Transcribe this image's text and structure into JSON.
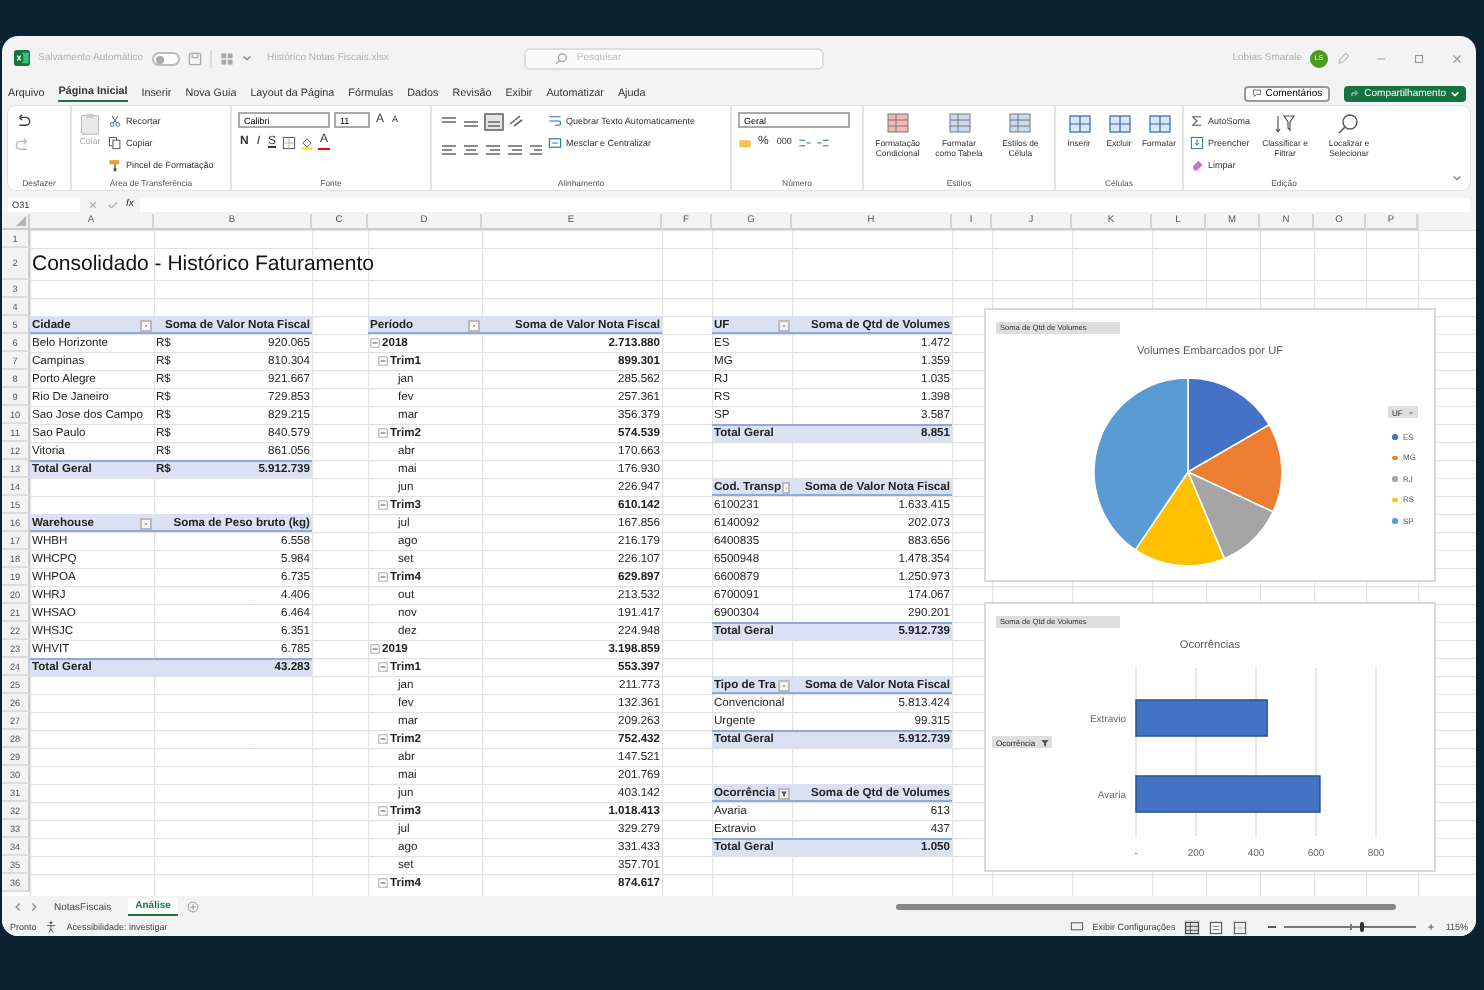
{
  "titlebar": {
    "autosave_label": "Salvamento Automático",
    "autosave_on": false,
    "filename": "Histórico Notas Fiscais.xlsx",
    "search_placeholder": "Pesquisar",
    "user_name": "Lobias Smarale",
    "user_initials": "LS"
  },
  "menu_tabs": [
    {
      "label": "Arquivo",
      "selected": false
    },
    {
      "label": "Página Inicial",
      "selected": true
    },
    {
      "label": "Inserir",
      "selected": false
    },
    {
      "label": "Nova Guia",
      "selected": false
    },
    {
      "label": "Layout da Página",
      "selected": false
    },
    {
      "label": "Fórmulas",
      "selected": false
    },
    {
      "label": "Dados",
      "selected": false
    },
    {
      "label": "Revisão",
      "selected": false
    },
    {
      "label": "Exibir",
      "selected": false
    },
    {
      "label": "Automatizar",
      "selected": false
    },
    {
      "label": "Ajuda",
      "selected": false
    }
  ],
  "comments_button": "Comentários",
  "share_button": "Compartilhamento",
  "ribbon": {
    "undo": {
      "group": "Desfazer"
    },
    "clipboard": {
      "group": "Área de Transferência",
      "paste": "Colar",
      "cut": "Recortar",
      "copy": "Copiar",
      "format_painter": "Pincel de Formatação"
    },
    "font": {
      "group": "Fonte",
      "family": "Calibri",
      "size": "11",
      "grow": "A",
      "shrink": "A",
      "bold": "N",
      "italic": "I",
      "underline": "S",
      "color_letter": "A"
    },
    "alignment": {
      "group": "Alinhamento",
      "wrap": "Quebrar Texto Automaticamente",
      "merge": "Mesclar e Centralizar"
    },
    "number": {
      "group": "Número",
      "format": "Geral",
      "percent": "%",
      "thousands": "000"
    },
    "styles": {
      "group": "Estilos",
      "items": [
        "Formatação Condicional",
        "Formatar como Tabela",
        "Estilos de Célula"
      ]
    },
    "cells": {
      "group": "Células",
      "items": [
        "Inserir",
        "Excluir",
        "Formatar"
      ]
    },
    "editing": {
      "group": "Edição",
      "autosum": "AutoSoma",
      "fill": "Preencher",
      "clear": "Limpar",
      "sort": "Classificar e Filtrar",
      "find": "Localizar e Selecionar"
    }
  },
  "formula_bar": {
    "cell_ref": "O31",
    "fx": "fx"
  },
  "sheet": {
    "columns": [
      "A",
      "B",
      "C",
      "D",
      "E",
      "F",
      "G",
      "H",
      "I",
      "J",
      "K",
      "L",
      "M",
      "N",
      "O",
      "P"
    ],
    "row_numbers": [
      "1",
      "2",
      "3",
      "4",
      "5",
      "6",
      "7",
      "8",
      "9",
      "10",
      "11",
      "12",
      "13",
      "14",
      "15",
      "16",
      "17",
      "18",
      "19",
      "20",
      "21",
      "22",
      "23",
      "24",
      "25",
      "26",
      "27",
      "28",
      "29",
      "30",
      "31",
      "32",
      "33",
      "34",
      "35",
      "36"
    ],
    "title": "Consolidado - Histórico Faturamento"
  },
  "pivots": [
    {
      "header": [
        "Cidade",
        "Soma de Valor Nota Fiscal"
      ],
      "filtered": false,
      "rows": [
        {
          "label": "Belo Horizonte",
          "currency": "R$",
          "value": "920.065"
        },
        {
          "label": "Campinas",
          "currency": "R$",
          "value": "810.304"
        },
        {
          "label": "Porto Alegre",
          "currency": "R$",
          "value": "921.667"
        },
        {
          "label": "Rio De Janeiro",
          "currency": "R$",
          "value": "729.853"
        },
        {
          "label": "Sao Jose dos Campo",
          "currency": "R$",
          "value": "829.215"
        },
        {
          "label": "Sao Paulo",
          "currency": "R$",
          "value": "840.579"
        },
        {
          "label": "Vitoria",
          "currency": "R$",
          "value": "861.056"
        }
      ],
      "total": {
        "label": "Total Geral",
        "currency": "R$",
        "value": "5.912.739"
      }
    },
    {
      "header": [
        "Warehouse",
        "Soma de Peso bruto (kg)"
      ],
      "filtered": false,
      "rows": [
        {
          "label": "WHBH",
          "value": "6.558"
        },
        {
          "label": "WHCPQ",
          "value": "5.984"
        },
        {
          "label": "WHPOA",
          "value": "6.735"
        },
        {
          "label": "WHRJ",
          "value": "4.406"
        },
        {
          "label": "WHSAO",
          "value": "6.464"
        },
        {
          "label": "WHSJC",
          "value": "6.351"
        },
        {
          "label": "WHVIT",
          "value": "6.785"
        }
      ],
      "total": {
        "label": "Total Geral",
        "value": "43.283"
      }
    },
    {
      "header": [
        "Período",
        "Soma de Valor Nota Fiscal"
      ],
      "filtered": false,
      "rows": [
        {
          "label": "2018",
          "value": "2.713.880",
          "expanded": true,
          "children": [
            {
              "label": "Trim1",
              "value": "899.301",
              "expanded": true,
              "children": [
                {
                  "label": "jan",
                  "value": "285.562"
                },
                {
                  "label": "fev",
                  "value": "257.361"
                },
                {
                  "label": "mar",
                  "value": "356.379"
                }
              ]
            },
            {
              "label": "Trim2",
              "value": "574.539",
              "expanded": true,
              "children": [
                {
                  "label": "abr",
                  "value": "170.663"
                },
                {
                  "label": "mai",
                  "value": "176.930"
                },
                {
                  "label": "jun",
                  "value": "226.947"
                }
              ]
            },
            {
              "label": "Trim3",
              "value": "610.142",
              "expanded": true,
              "children": [
                {
                  "label": "jul",
                  "value": "167.856"
                },
                {
                  "label": "ago",
                  "value": "216.179"
                },
                {
                  "label": "set",
                  "value": "226.107"
                }
              ]
            },
            {
              "label": "Trim4",
              "value": "629.897",
              "expanded": true,
              "children": [
                {
                  "label": "out",
                  "value": "213.532"
                },
                {
                  "label": "nov",
                  "value": "191.417"
                },
                {
                  "label": "dez",
                  "value": "224.948"
                }
              ]
            }
          ]
        },
        {
          "label": "2019",
          "value": "3.198.859",
          "expanded": true,
          "children": [
            {
              "label": "Trim1",
              "value": "553.397",
              "expanded": true,
              "children": [
                {
                  "label": "jan",
                  "value": "211.773"
                },
                {
                  "label": "fev",
                  "value": "132.361"
                },
                {
                  "label": "mar",
                  "value": "209.263"
                }
              ]
            },
            {
              "label": "Trim2",
              "value": "752.432",
              "expanded": true,
              "children": [
                {
                  "label": "abr",
                  "value": "147.521"
                },
                {
                  "label": "mai",
                  "value": "201.769"
                },
                {
                  "label": "jun",
                  "value": "403.142"
                }
              ]
            },
            {
              "label": "Trim3",
              "value": "1.018.413",
              "expanded": true,
              "children": [
                {
                  "label": "jul",
                  "value": "329.279"
                },
                {
                  "label": "ago",
                  "value": "331.433"
                },
                {
                  "label": "set",
                  "value": "357.701"
                }
              ]
            },
            {
              "label": "Trim4",
              "value": "874.617",
              "expanded": true
            }
          ]
        }
      ]
    },
    {
      "header": [
        "UF",
        "Soma de Qtd de Volumes"
      ],
      "filtered": false,
      "rows": [
        {
          "label": "ES",
          "value": "1.472"
        },
        {
          "label": "MG",
          "value": "1.359"
        },
        {
          "label": "RJ",
          "value": "1.035"
        },
        {
          "label": "RS",
          "value": "1.398"
        },
        {
          "label": "SP",
          "value": "3.587"
        }
      ],
      "total": {
        "label": "Total Geral",
        "value": "8.851"
      }
    },
    {
      "header": [
        "Cod. Transp",
        "Soma de Valor Nota Fiscal"
      ],
      "filtered": false,
      "rows": [
        {
          "label": "6100231",
          "value": "1.633.415"
        },
        {
          "label": "6140092",
          "value": "202.073"
        },
        {
          "label": "6400835",
          "value": "883.656"
        },
        {
          "label": "6500948",
          "value": "1.478.354"
        },
        {
          "label": "6600879",
          "value": "1.250.973"
        },
        {
          "label": "6700091",
          "value": "174.067"
        },
        {
          "label": "6900304",
          "value": "290.201"
        }
      ],
      "total": {
        "label": "Total Geral",
        "value": "5.912.739"
      }
    },
    {
      "header": [
        "Tipo de Tra",
        "Soma de Valor Nota Fiscal"
      ],
      "filtered": false,
      "rows": [
        {
          "label": "Convencional",
          "value": "5.813.424"
        },
        {
          "label": "Urgente",
          "value": "99.315"
        }
      ],
      "total": {
        "label": "Total Geral",
        "value": "5.912.739"
      }
    },
    {
      "header": [
        "Ocorrência",
        "Soma de Qtd de Volumes"
      ],
      "filtered": true,
      "rows": [
        {
          "label": "Avaria",
          "value": "613"
        },
        {
          "label": "Extravio",
          "value": "437"
        }
      ],
      "total": {
        "label": "Total Geral",
        "value": "1.050"
      }
    }
  ],
  "pie_chart": {
    "field_button": "Soma de Qtd de Volumes",
    "legend_button": "UF",
    "slices": [
      {
        "color": "#4472c4"
      },
      {
        "color": "#ed7d31"
      },
      {
        "color": "#a5a5a5"
      },
      {
        "color": "#ffc000"
      },
      {
        "color": "#5b9bd5"
      }
    ],
    "chart_data": {
      "type": "pie",
      "title": "Volumes Embarcados por UF",
      "legend": "right",
      "categories": [
        "ES",
        "MG",
        "RJ",
        "RS",
        "SP"
      ],
      "values": [
        16.63,
        15.35,
        11.69,
        15.8,
        40.53
      ]
    }
  },
  "bar_chart": {
    "field_button": "Soma de Qtd de Volumes",
    "axis_button": "Ocorrência",
    "chart_data": {
      "type": "bar",
      "orientation": "horizontal",
      "grid": true,
      "title": "Ocorrências",
      "categories": [
        "Extravio",
        "Avaria"
      ],
      "values": [
        437,
        613
      ],
      "xlim": [
        0,
        800
      ],
      "xticks": [
        {
          "value": 0,
          "label": "-"
        },
        {
          "value": 200,
          "label": "200"
        },
        {
          "value": 400,
          "label": "400"
        },
        {
          "value": 600,
          "label": "600"
        },
        {
          "value": 800,
          "label": "800"
        }
      ]
    }
  },
  "sheet_tabs": [
    {
      "label": "NotasFiscais",
      "selected": false
    },
    {
      "label": "Análise",
      "selected": true
    }
  ],
  "status_bar": {
    "ready": "Pronto",
    "accessibility": "Acessibilidade: investigar",
    "display_settings": "Exibir Configurações",
    "zoom": {
      "level": 0.6,
      "reading": "115%"
    }
  }
}
